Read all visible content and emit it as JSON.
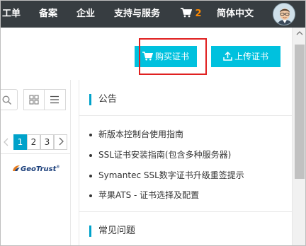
{
  "nav": {
    "items": [
      "工单",
      "备案",
      "企业",
      "支持与服务"
    ],
    "cart_count": "2",
    "language": "简体中文"
  },
  "buttons": {
    "buy": "购买证书",
    "upload": "上传证书"
  },
  "pagination": {
    "pages": [
      "1",
      "2",
      "3"
    ],
    "active": "1"
  },
  "brand": {
    "geotrust": "GeoTrust"
  },
  "announcements": {
    "title": "公告",
    "items": [
      "新版本控制台使用指南",
      "SSL证书安装指南(包含多种服务器)",
      "Symantec SSL数字证书升级重签提示",
      "苹果ATS - 证书选择及配置"
    ]
  },
  "faq": {
    "title": "常见问题"
  },
  "colors": {
    "topbar": "#373d41",
    "accent": "#00c1de",
    "highlight": "#e02020",
    "cart_count": "#ff8a00"
  },
  "icons": [
    "cart-icon",
    "upload-icon",
    "search-icon",
    "grid-view-icon",
    "list-view-icon",
    "chevron-left-icon",
    "chevron-right-icon",
    "chevron-up-icon"
  ]
}
